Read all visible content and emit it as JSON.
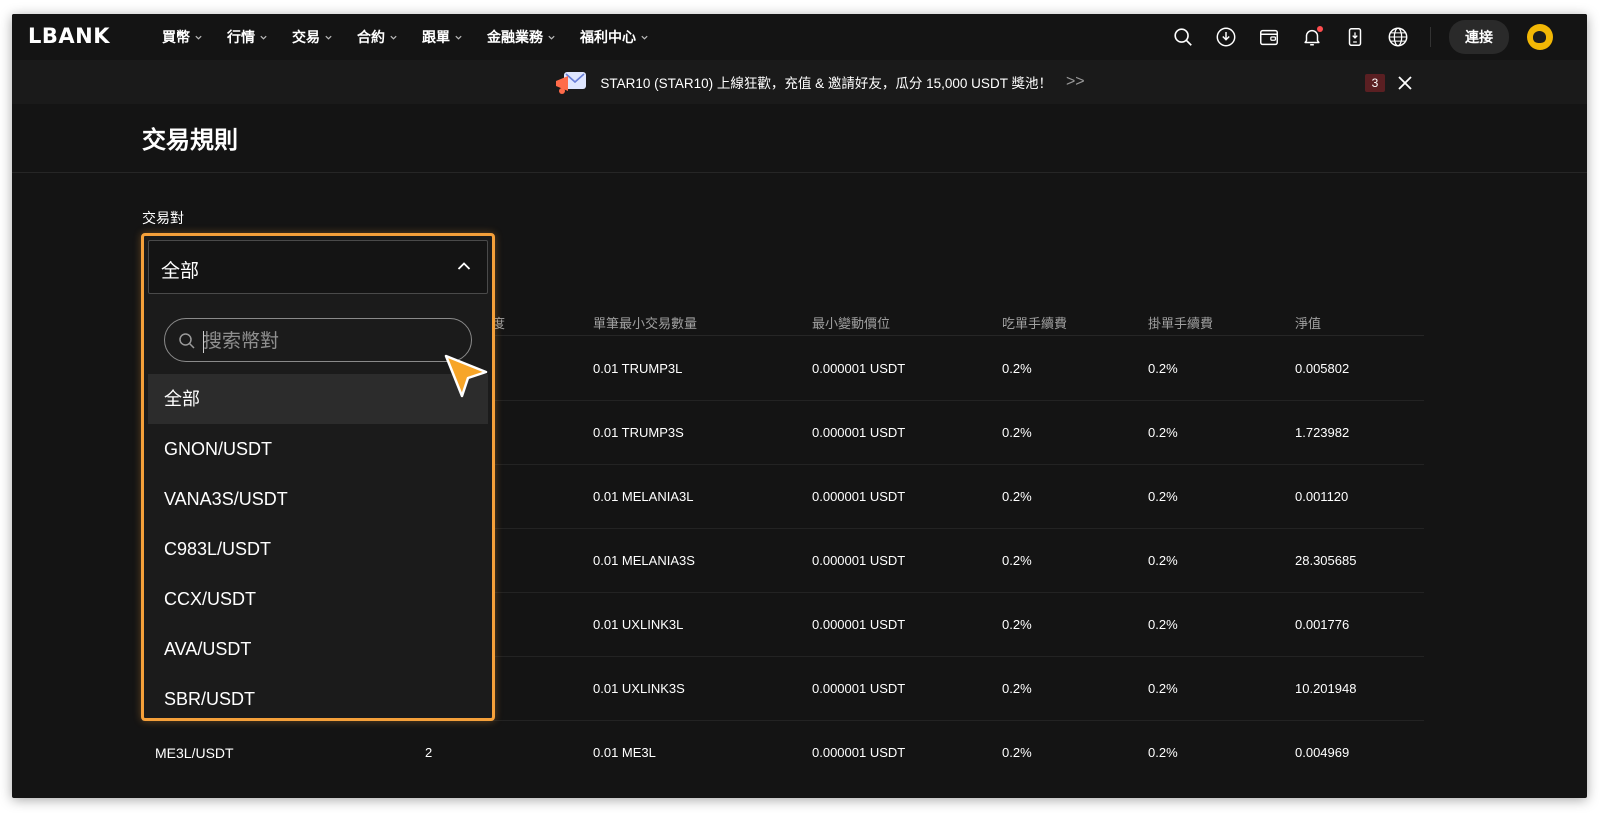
{
  "header": {
    "logo": "LBANK",
    "nav": [
      "買幣",
      "行情",
      "交易",
      "合約",
      "跟單",
      "金融業務",
      "福利中心"
    ],
    "icons": [
      "search-icon",
      "download-icon",
      "wallet-icon",
      "bell-icon",
      "mobile-app-icon",
      "globe-icon"
    ],
    "connect_label": "連接"
  },
  "announcement": {
    "text": "STAR10 (STAR10) 上線狂歡，充值 & 邀請好友，瓜分 15,000 USDT 獎池！",
    "arrow": ">>",
    "count": "3"
  },
  "page": {
    "title": "交易規則",
    "pair_label": "交易對"
  },
  "dropdown": {
    "selected": "全部",
    "search_placeholder": "搜索幣對",
    "options": [
      "全部",
      "GNON/USDT",
      "VANA3S/USDT",
      "C983L/USDT",
      "CCX/USDT",
      "AVA/USDT",
      "SBR/USDT"
    ]
  },
  "table": {
    "headers": [
      "度",
      "單筆最小交易數量",
      "最小變動價位",
      "吃單手續費",
      "掛單手續費",
      "淨值"
    ],
    "rows": [
      {
        "min_qty": "0.01 TRUMP3L",
        "tick": "0.000001 USDT",
        "taker": "0.2%",
        "maker": "0.2%",
        "nav": "0.005802"
      },
      {
        "min_qty": "0.01 TRUMP3S",
        "tick": "0.000001 USDT",
        "taker": "0.2%",
        "maker": "0.2%",
        "nav": "1.723982"
      },
      {
        "min_qty": "0.01 MELANIA3L",
        "tick": "0.000001 USDT",
        "taker": "0.2%",
        "maker": "0.2%",
        "nav": "0.001120"
      },
      {
        "min_qty": "0.01 MELANIA3S",
        "tick": "0.000001 USDT",
        "taker": "0.2%",
        "maker": "0.2%",
        "nav": "28.305685"
      },
      {
        "min_qty": "0.01 UXLINK3L",
        "tick": "0.000001 USDT",
        "taker": "0.2%",
        "maker": "0.2%",
        "nav": "0.001776"
      },
      {
        "min_qty": "0.01 UXLINK3S",
        "tick": "0.000001 USDT",
        "taker": "0.2%",
        "maker": "0.2%",
        "nav": "10.201948"
      },
      {
        "pair": "ME3L/USDT",
        "precision": "2",
        "min_qty": "0.01 ME3L",
        "tick": "0.000001 USDT",
        "taker": "0.2%",
        "maker": "0.2%",
        "nav": "0.004969"
      }
    ]
  },
  "colors": {
    "background": "#141414",
    "highlight": "#f5a03a",
    "cursor": "#f7a528"
  }
}
